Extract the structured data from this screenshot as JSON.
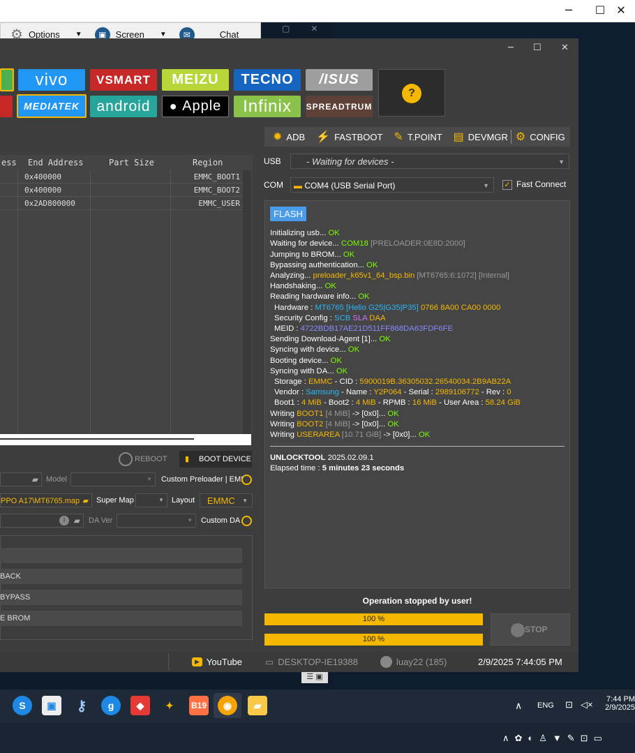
{
  "outer_window": {
    "minimize": "─",
    "maximize": "☐",
    "close": "✕"
  },
  "toolbar": {
    "options": "Options",
    "screen": "Screen",
    "chat": "Chat"
  },
  "app_window": {
    "minimize": "─",
    "maximize": "☐",
    "close": "✕"
  },
  "brands": {
    "vivo": "vivo",
    "vsmart": "VSMART",
    "meizu": "MEIZU",
    "tecno": "TECNO",
    "asus": "/ISUS",
    "mediatek": "MEDIATEK",
    "android": "android",
    "apple": "Apple",
    "infinix": "Infinix",
    "spreadtrum": "SPREADTRUM",
    "help": "?"
  },
  "rtoolbar": {
    "adb": "ADB",
    "fastboot": "FASTBOOT",
    "tpoint": "T.POINT",
    "devmgr": "DEVMGR",
    "config": "CONFIG"
  },
  "usb": {
    "label": "USB",
    "value": "- Waiting for devices -"
  },
  "com": {
    "label": "COM",
    "value": "COM4 (USB Serial Port)",
    "fast_connect": "Fast Connect"
  },
  "table": {
    "headers": {
      "c0": "ess",
      "c1": "End Address",
      "c2": "Part Size",
      "c3": "Region"
    },
    "rows": [
      {
        "end": "0x400000",
        "region": "EMMC_BOOT1"
      },
      {
        "end": "0x400000",
        "region": "EMMC_BOOT2"
      },
      {
        "end": "0x2AD800000",
        "region": "EMMC_USER"
      }
    ]
  },
  "controls": {
    "reboot": "REBOOT",
    "boot_device": "BOOT DEVICE",
    "model": "Model",
    "custom_preloader": "Custom Preloader | EMI",
    "map_value": "PPO A17\\MT6765.map",
    "super_map": "Super Map",
    "layout": "Layout",
    "layout_value": "EMMC",
    "da_ver": "DA Ver",
    "custom_da": "Custom DA",
    "slot_back": "BACK",
    "slot_bypass": "BYPASS",
    "slot_brom": "E BROM"
  },
  "log": {
    "tag": "FLASH",
    "l1": "Initializing usb... ",
    "ok": "OK",
    "l2": "Waiting for device... ",
    "l2a": "COM18",
    "l2b": " [PRELOADER:0E8D:2000]",
    "l3": "Jumping to BROM... ",
    "l4": "Bypassing authentication... ",
    "l5": "Analyzing... ",
    "l5a": "preloader_k65v1_64_bsp.bin",
    "l5b": " [MT6765:6:1072] [Internal]",
    "l6": "Handshaking... ",
    "l7": "Reading hardware info... ",
    "l8": "Hardware : ",
    "l8a": "MT6765 [Helio G25|G35|P35]",
    "l8b": " 0766 8A00 CA00 0000",
    "l9": "Security Config : ",
    "l9a": "SCB",
    "l9b": " SLA",
    "l9c": " DAA",
    "l10": "MEID : ",
    "l10a": "4722BDB17AE21D511FF868DA63FDF6FE",
    "l11": "Sending Download-Agent [1]... ",
    "l12": "Syncing with device... ",
    "l13": "Booting device... ",
    "l14": "Syncing with DA... ",
    "l15": "Storage : ",
    "l15a": "EMMC",
    "l15b": " - CID : ",
    "l15c": "5900019B.36305032.26540034.2B9AB22A",
    "l16": "Vendor : ",
    "l16a": "Samsung",
    "l16b": " - Name : ",
    "l16c": "Y2P064",
    "l16d": " - Serial : ",
    "l16e": "2989106772",
    "l16f": " - Rev : ",
    "l16g": "0",
    "l17": "Boot1 : ",
    "l17a": "4 MiB",
    "l17b": " - Boot2 : ",
    "l17c": "4 MiB",
    "l17d": " - RPMB : ",
    "l17e": "16 MiB",
    "l17f": " - User Area : ",
    "l17g": "58.24 GiB",
    "w1": "Writing ",
    "w1a": "BOOT1",
    "w1b": " [4 MiB]",
    "w1c": " -> [0x0]... ",
    "w2a": "BOOT2",
    "w2b": " [4 MiB]",
    "w3a": "USERAREA",
    "w3b": " [10.71 GiB]",
    "ver": "UNLOCKTOOL",
    "ver_val": " 2025.02.09.1",
    "elapsed": "Elapsed time : ",
    "elapsed_val": "5 minutes 23 seconds"
  },
  "status": {
    "message": "Operation stopped by user!",
    "progress1": "100 %",
    "progress2": "100 %",
    "progress_value": 1.0,
    "stop": "STOP"
  },
  "statusbar": {
    "youtube": "YouTube",
    "pc": "DESKTOP-IE19388",
    "user": "luay22 (185)",
    "datetime": "2/9/2025 7:44:05 PM"
  },
  "taskbar": {
    "lang": "ENG",
    "time": "7:44 PM",
    "date": "2/9/2025",
    "b19": "B19"
  }
}
